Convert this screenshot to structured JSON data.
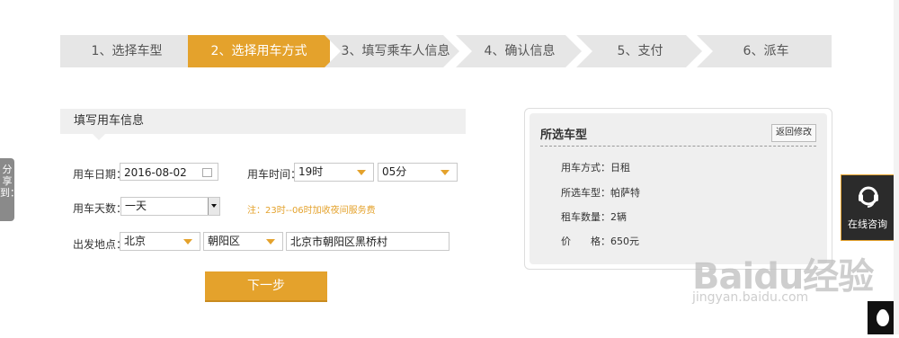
{
  "steps": [
    {
      "label": "1、选择车型",
      "active": false
    },
    {
      "label": "2、选择用车方式",
      "active": true
    },
    {
      "label": "3、填写乘车人信息",
      "active": false
    },
    {
      "label": "4、确认信息",
      "active": false
    },
    {
      "label": "5、支付",
      "active": false
    },
    {
      "label": "6、派车",
      "active": false
    }
  ],
  "form": {
    "section_title": "填写用车信息",
    "date_label": "用车日期：",
    "date_value": "2016-08-02",
    "time_label": "用车时间：",
    "hour_value": "19时",
    "minute_value": "05分",
    "days_label": "用车天数：",
    "days_value": "一天",
    "note": "注：23时--06时加收夜间服务费",
    "place_label": "出发地点：",
    "city_value": "北京",
    "district_value": "朝阳区",
    "address_value": "北京市朝阳区黑桥村",
    "next_button": "下一步"
  },
  "summary": {
    "title": "所选车型",
    "back_button": "返回修改",
    "rows": [
      {
        "label": "用车方式：",
        "value": "日租"
      },
      {
        "label": "所选车型：",
        "value": "帕萨特"
      },
      {
        "label": "租车数量：",
        "value": "2辆"
      },
      {
        "label": "价　　格：",
        "value": "650元"
      }
    ]
  },
  "side": {
    "share_label": "分享到：",
    "consult_label": "在线咨询"
  },
  "watermark": {
    "brand": "Baidu经验",
    "url": "jingyan.baidu.com"
  },
  "colors": {
    "accent": "#e4a22c",
    "step_bg": "#e6e6e6"
  }
}
